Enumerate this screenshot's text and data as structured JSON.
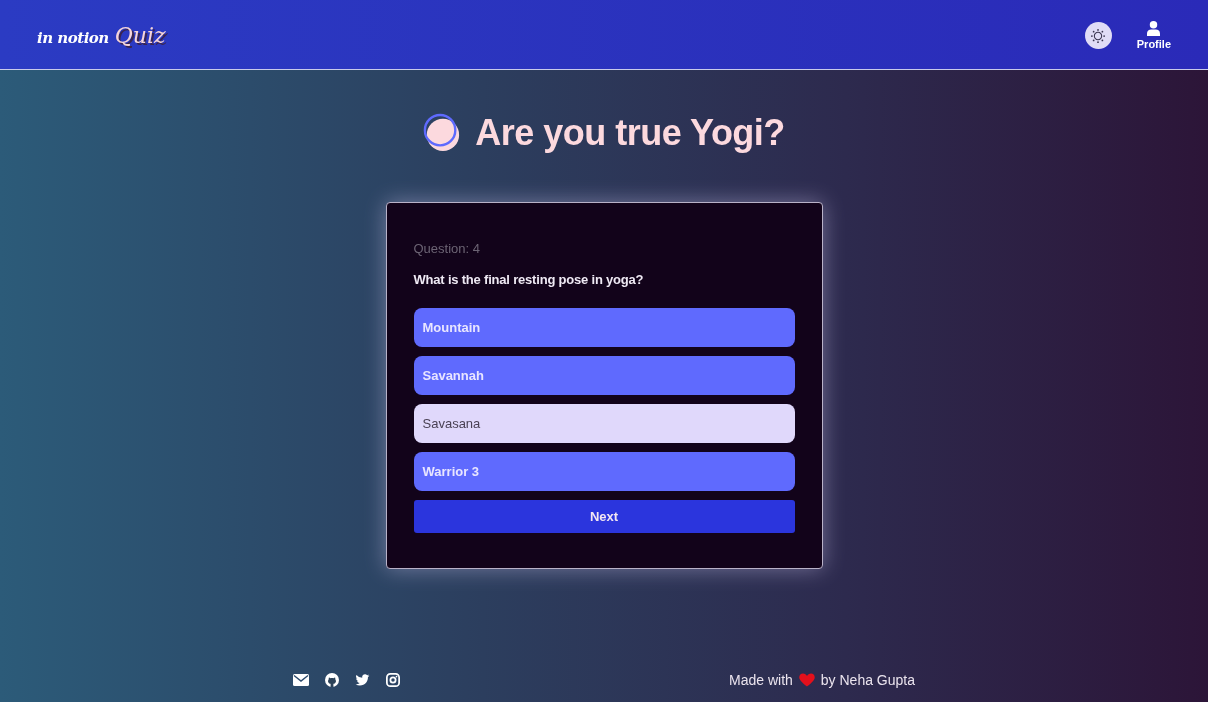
{
  "header": {
    "logo": {
      "script_part": "in notion",
      "highlight_part": "Quiz"
    },
    "profile_label": "Profile"
  },
  "quiz": {
    "title": "Are you true Yogi?",
    "question_label": "Question: 4",
    "question_text": "What is the final resting pose in yoga?",
    "options": [
      {
        "label": "Mountain",
        "selected": false
      },
      {
        "label": "Savannah",
        "selected": false
      },
      {
        "label": "Savasana",
        "selected": true
      },
      {
        "label": "Warrior 3",
        "selected": false
      }
    ],
    "next_button": "Next"
  },
  "footer": {
    "credit_prefix": "Made with",
    "credit_suffix": "by Neha Gupta"
  }
}
